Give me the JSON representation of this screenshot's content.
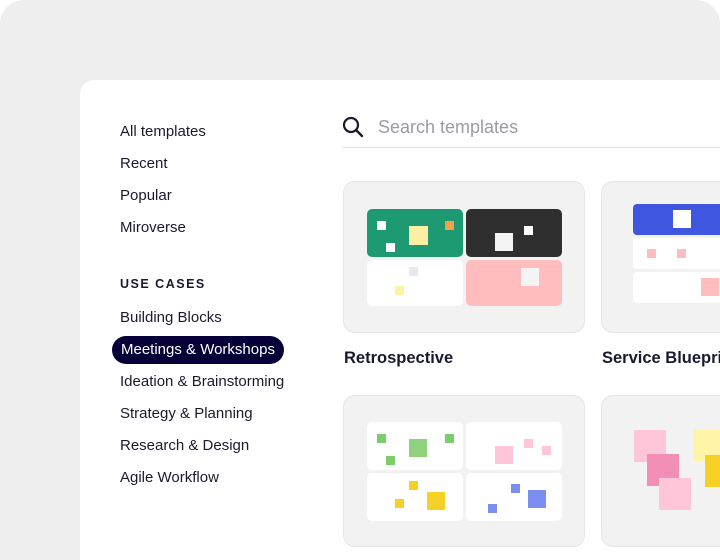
{
  "sidebar": {
    "items": [
      {
        "label": "All templates"
      },
      {
        "label": "Recent"
      },
      {
        "label": "Popular"
      },
      {
        "label": "Miroverse"
      }
    ],
    "use_cases_heading": "USE CASES",
    "use_cases": [
      {
        "label": "Building Blocks"
      },
      {
        "label": "Meetings & Workshops",
        "active": true
      },
      {
        "label": "Ideation & Brainstorming"
      },
      {
        "label": "Strategy & Planning"
      },
      {
        "label": "Research & Design"
      },
      {
        "label": "Agile Workflow"
      }
    ]
  },
  "search": {
    "placeholder": "Search templates",
    "icon": "search-icon"
  },
  "templates": [
    {
      "title": "Retrospective"
    },
    {
      "title": "Service Blueprint"
    },
    {
      "title": ""
    },
    {
      "title": ""
    }
  ],
  "colors": {
    "active_bg": "#050038",
    "green": "#1e9a72",
    "dark": "#2f2f2f",
    "pink": "#ffbdbd",
    "blue": "#3e56e0"
  }
}
